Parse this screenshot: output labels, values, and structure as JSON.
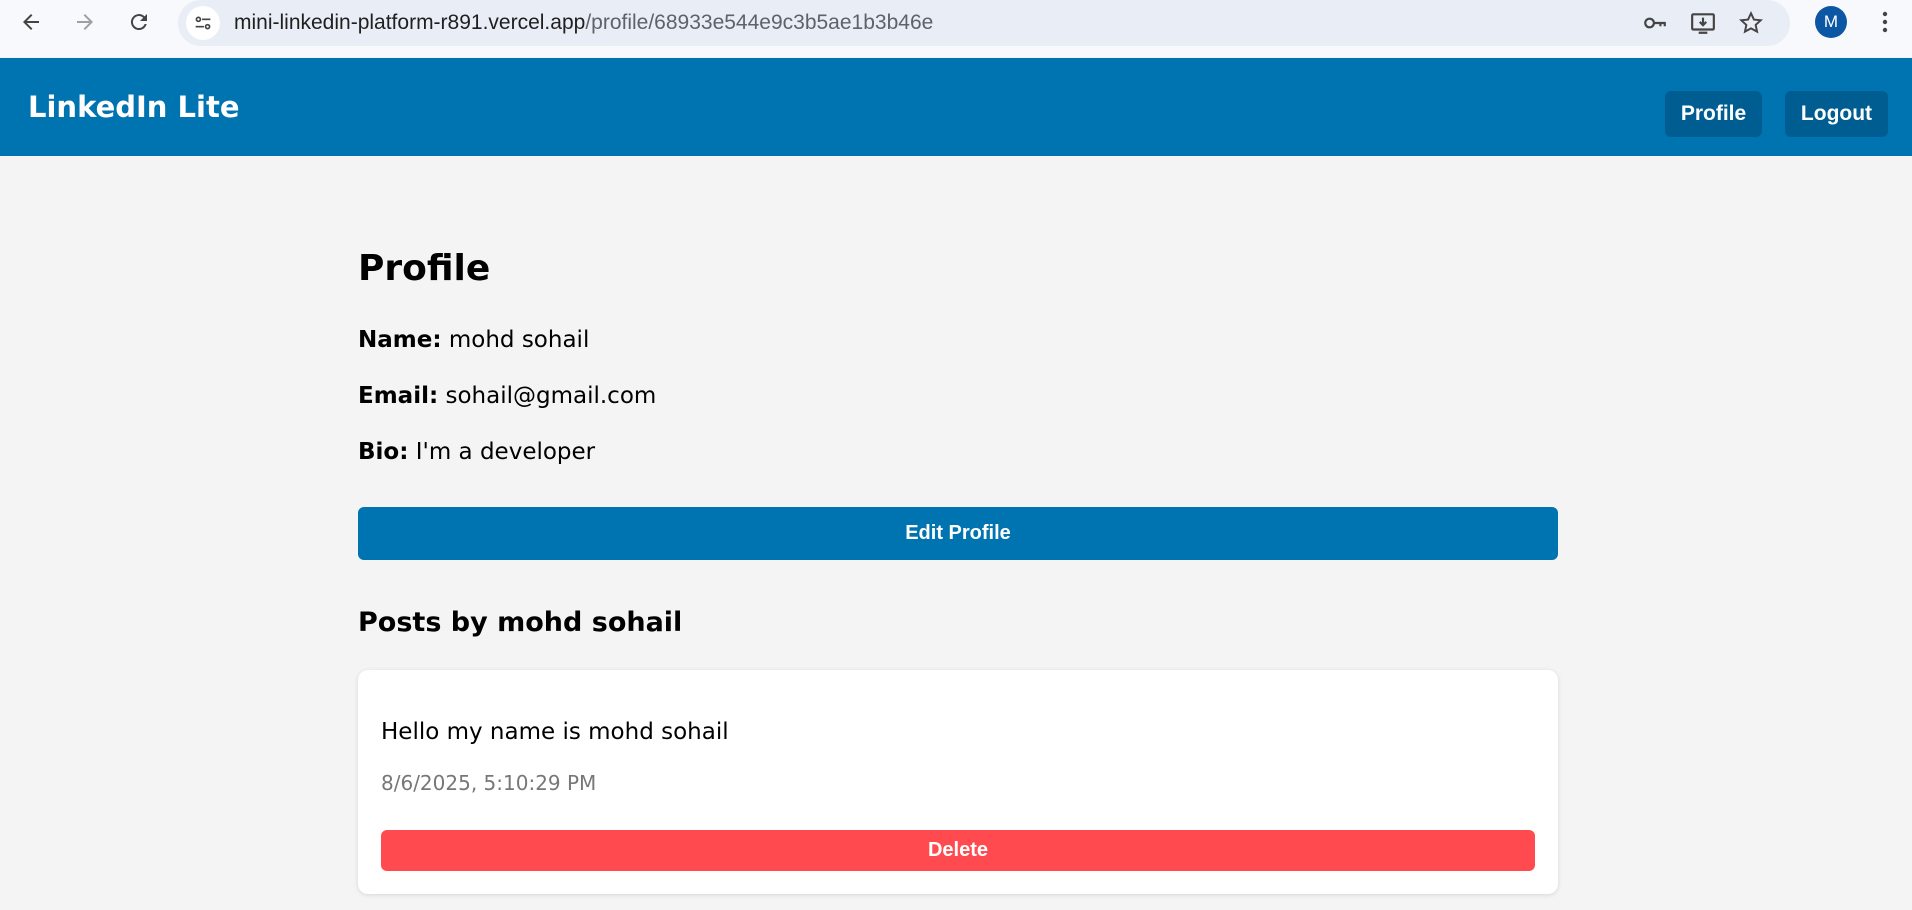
{
  "browser": {
    "url_host": "mini-linkedin-platform-r891.vercel.app",
    "url_path": "/profile/68933e544e9c3b5ae1b3b46e",
    "avatar_letter": "M",
    "icons": [
      "back-icon",
      "forward-icon",
      "reload-icon",
      "site-settings-icon",
      "key-icon",
      "install-icon",
      "star-icon",
      "kebab-menu-icon"
    ]
  },
  "header": {
    "brand": "LinkedIn Lite",
    "profile_label": "Profile",
    "logout_label": "Logout"
  },
  "profile": {
    "title": "Profile",
    "name_label": "Name:",
    "name_value": "mohd sohail",
    "email_label": "Email:",
    "email_value": "sohail@gmail.com",
    "bio_label": "Bio:",
    "bio_value": "I'm a developer",
    "edit_label": "Edit Profile"
  },
  "posts": {
    "title": "Posts by mohd sohail",
    "items": [
      {
        "content": "Hello my name is mohd sohail",
        "timestamp": "8/6/2025, 5:10:29 PM",
        "delete_label": "Delete"
      }
    ]
  },
  "colors": {
    "brand_blue": "#0073b1",
    "header_button": "#005d92",
    "delete_red": "#ff4b4f",
    "background": "#f4f4f4"
  }
}
